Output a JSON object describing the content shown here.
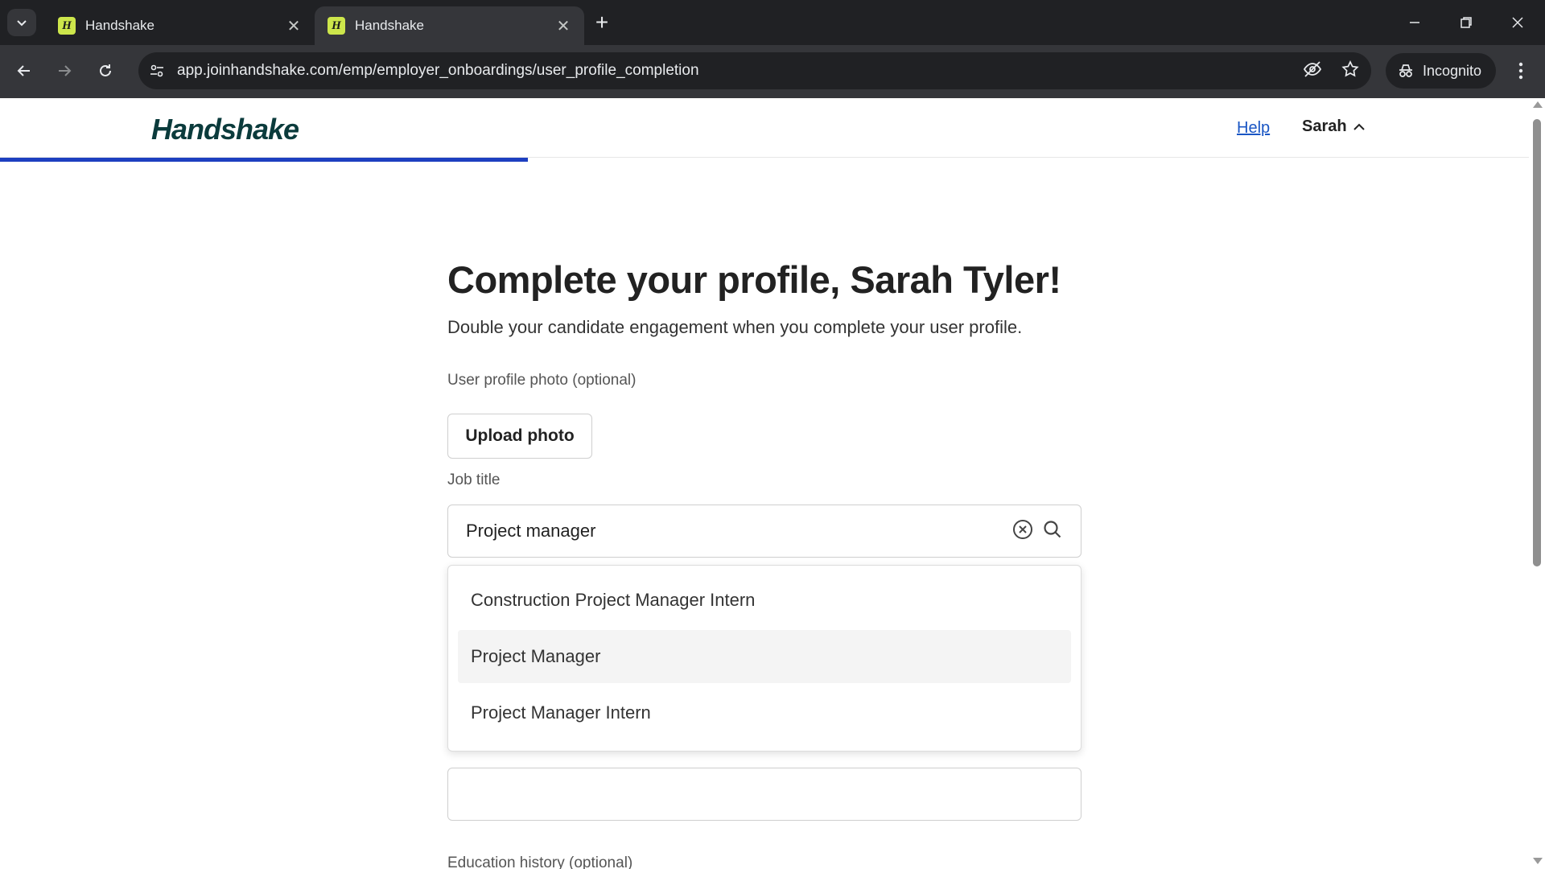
{
  "browser": {
    "tabs": [
      {
        "title": "Handshake",
        "favicon": "H",
        "active": false
      },
      {
        "title": "Handshake",
        "favicon": "H",
        "active": true
      }
    ],
    "url": "app.joinhandshake.com/emp/employer_onboardings/user_profile_completion",
    "incognito_label": "Incognito"
  },
  "header": {
    "logo": "Handshake",
    "help": "Help",
    "user": "Sarah",
    "progress_fraction": 0.345
  },
  "form": {
    "title": "Complete your profile, Sarah Tyler!",
    "subtitle": "Double your candidate engagement when you complete your user profile.",
    "photo_label": "User profile photo (optional)",
    "upload_button": "Upload photo",
    "job_title_label": "Job title",
    "job_title_value": "Project manager",
    "suggestions": [
      "Construction Project Manager Intern",
      "Project Manager",
      "Project Manager Intern"
    ],
    "education_label": "Education history (optional)"
  },
  "colors": {
    "accent": "#1d3fc0",
    "logo": "#0b3b3c",
    "link": "#1a56c4",
    "favicon": "#cde64b"
  }
}
